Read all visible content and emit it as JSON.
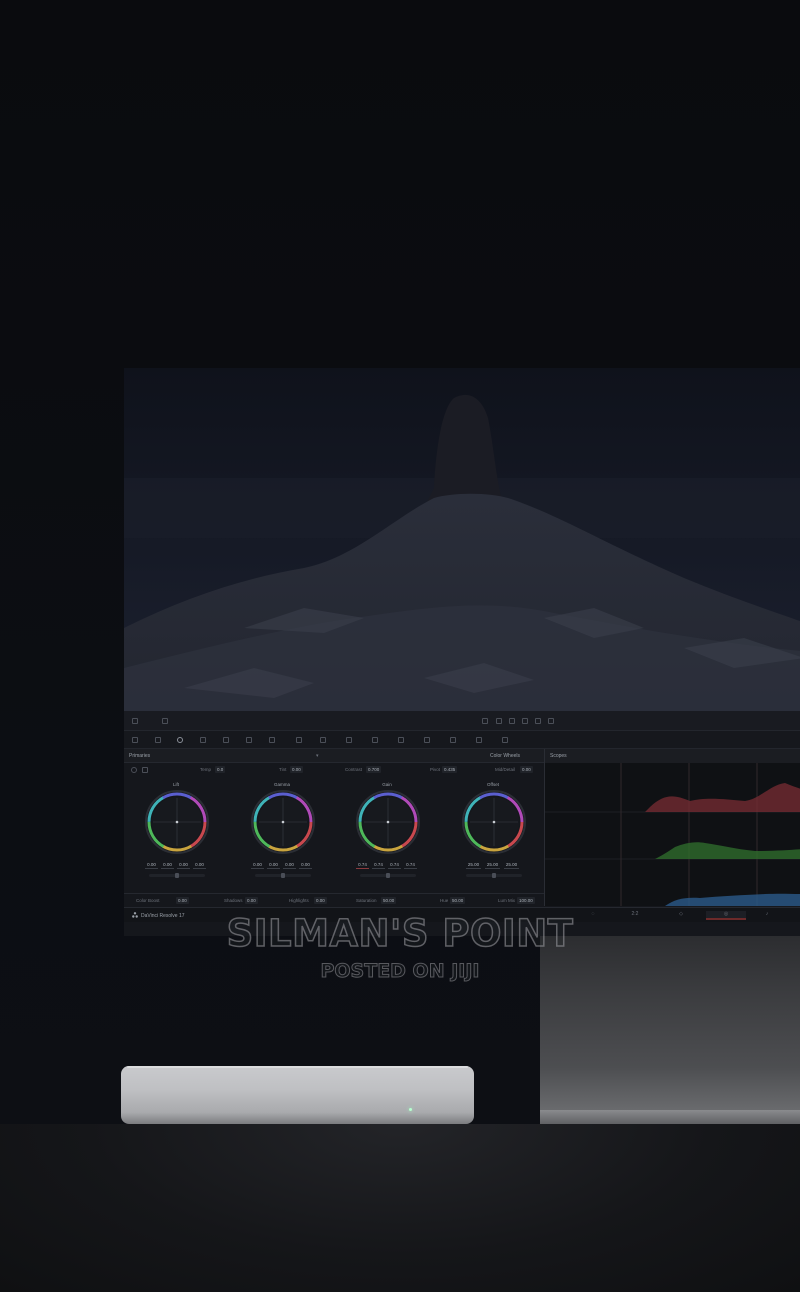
{
  "resolve_ui": {
    "app_name": "DaVinci Resolve 17",
    "panel_title": "Primaries",
    "mode_label": "Color Wheels",
    "scopes_title": "Scopes",
    "params_top": [
      {
        "label": "Temp",
        "value": "0.0"
      },
      {
        "label": "Tint",
        "value": "0.00"
      },
      {
        "label": "Contrast",
        "value": "0.700"
      },
      {
        "label": "Pivot",
        "value": "0.435"
      },
      {
        "label": "Mid/Detail",
        "value": "0.00"
      }
    ],
    "wheels": [
      {
        "name": "Lift",
        "values": [
          "0.00",
          "0.00",
          "0.00",
          "0.00"
        ]
      },
      {
        "name": "Gamma",
        "values": [
          "0.00",
          "0.00",
          "0.00",
          "0.00"
        ]
      },
      {
        "name": "Gain",
        "values": [
          "0.74",
          "0.74",
          "0.74",
          "0.74"
        ]
      },
      {
        "name": "Offset",
        "values": [
          "25.00",
          "25.00",
          "25.00"
        ]
      }
    ],
    "params_bottom": [
      {
        "label": "Color Boost",
        "value": "0.00"
      },
      {
        "label": "Shadows",
        "value": "0.00"
      },
      {
        "label": "Highlights",
        "value": "0.00"
      },
      {
        "label": "Saturation",
        "value": "50.00"
      },
      {
        "label": "Hue",
        "value": "50.00"
      },
      {
        "label": "Lum Mix",
        "value": "100.00"
      }
    ],
    "page_tabs": [
      "2:2"
    ]
  },
  "watermark": {
    "title": "SILMAN'S POINT",
    "subtitle": "POSTED ON JIJI"
  },
  "colors": {
    "background": "#0b0c10",
    "scope_red": "#7a2c33",
    "scope_green": "#2e6b2c",
    "scope_blue": "#2a5a8a"
  }
}
